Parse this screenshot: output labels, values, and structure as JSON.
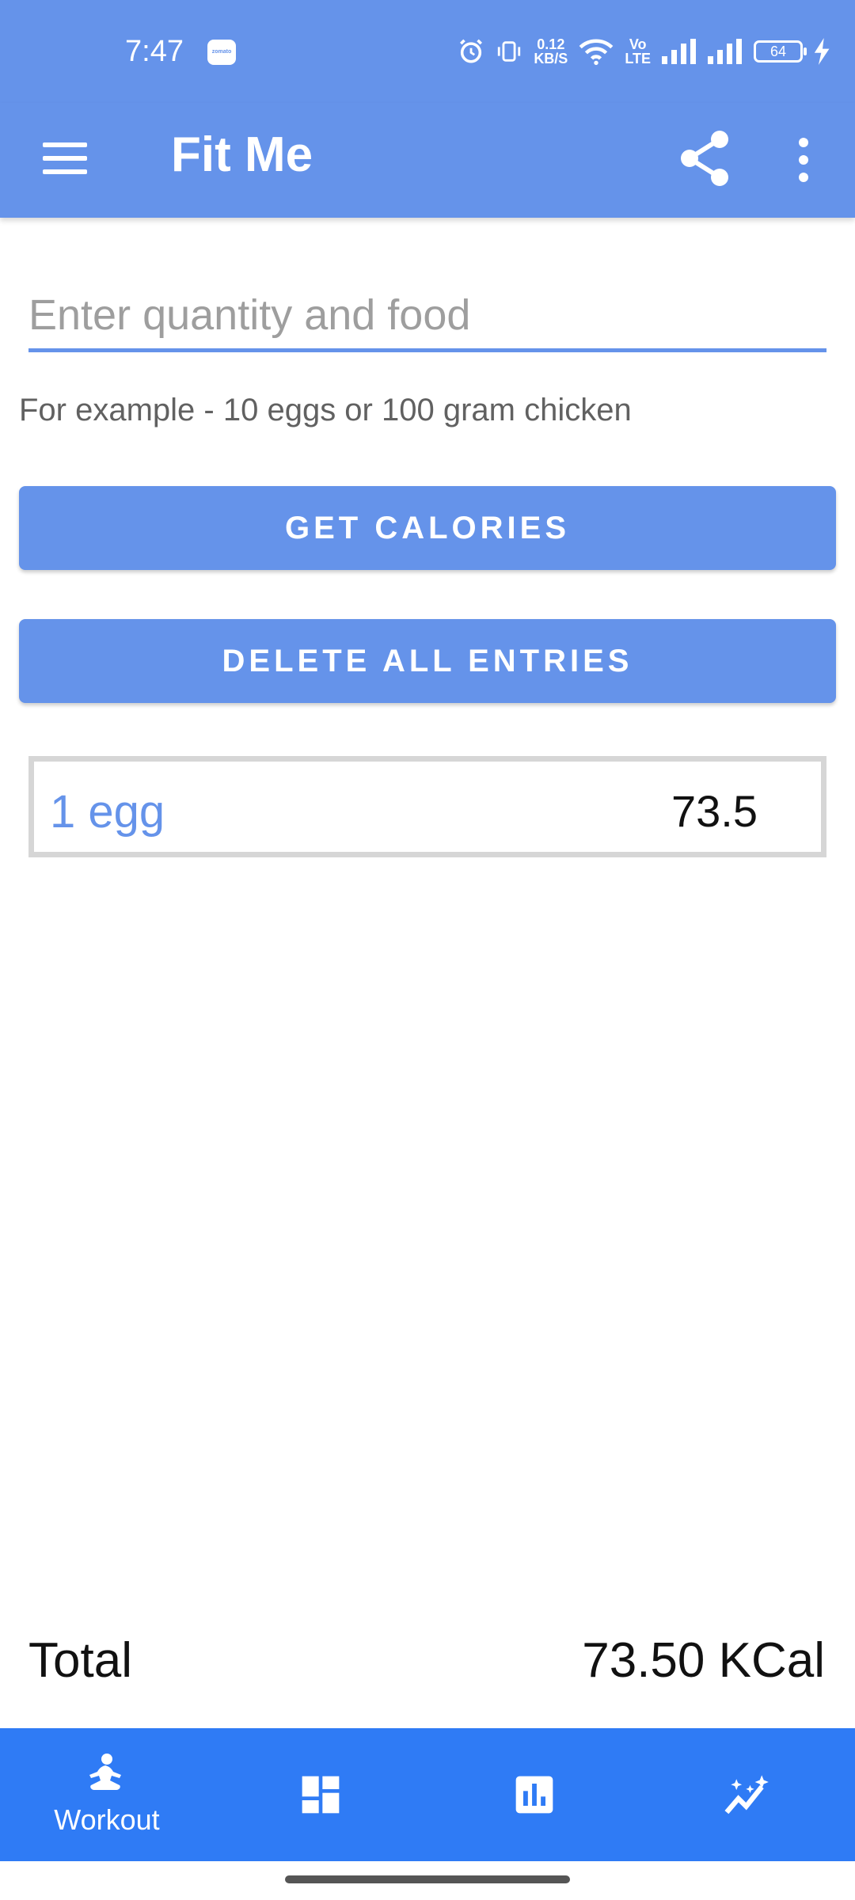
{
  "status_bar": {
    "time": "7:47",
    "notification_app": "zomato",
    "net_speed_value": "0.12",
    "net_speed_unit": "KB/S",
    "volte_top": "Vo",
    "volte_bottom": "LTE",
    "battery": "64"
  },
  "app_bar": {
    "title": "Fit Me",
    "menu_icon": "hamburger-icon",
    "share_icon": "share-icon",
    "more_icon": "more-vert-icon"
  },
  "form": {
    "food_input_placeholder": "Enter quantity and food",
    "food_input_value": "",
    "hint": "For example - 10 eggs or 100 gram chicken",
    "get_calories_label": "GET CALORIES",
    "delete_all_label": "DELETE ALL ENTRIES"
  },
  "entries": [
    {
      "food": "1 egg",
      "calories": "73.5"
    }
  ],
  "total": {
    "label": "Total",
    "value": "73.50 KCal"
  },
  "bottom_nav": [
    {
      "label": "Workout",
      "icon": "meditation-icon"
    },
    {
      "label": "",
      "icon": "dashboard-icon"
    },
    {
      "label": "",
      "icon": "bar-chart-icon"
    },
    {
      "label": "",
      "icon": "insights-icon"
    }
  ],
  "colors": {
    "primary": "#6593EA",
    "bottom_nav": "#2F7BF5"
  }
}
